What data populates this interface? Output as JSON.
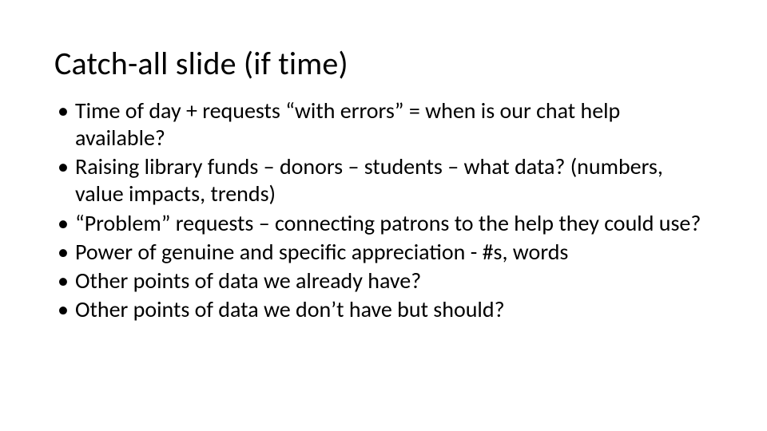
{
  "slide": {
    "title": "Catch-all slide (if time)",
    "bullets": [
      "Time of day + requests “with errors” = when is our chat help available?",
      "Raising library funds – donors – students – what data? (numbers, value impacts, trends)",
      "“Problem” requests – connecting patrons to the help they could use?",
      "Power of genuine and specific appreciation - #s, words",
      "Other points of data we already have?",
      "Other points of data we don’t have but should?"
    ]
  }
}
